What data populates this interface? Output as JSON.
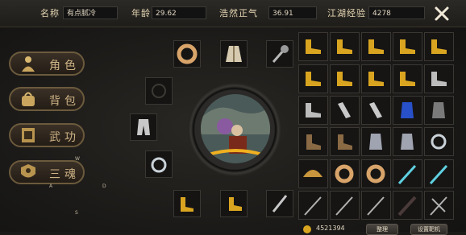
{
  "stats": [
    {
      "label": "名称",
      "value": "有点腻冷"
    },
    {
      "label": "年龄",
      "value": "29.62"
    },
    {
      "label": "浩然正气",
      "value": "36.91"
    },
    {
      "label": "江湖经验",
      "value": "4278"
    }
  ],
  "close_icon": "close-x-icon",
  "menu": [
    {
      "label": "角色",
      "icon": "character-icon"
    },
    {
      "label": "背包",
      "icon": "bag-icon"
    },
    {
      "label": "武功",
      "icon": "scroll-icon"
    },
    {
      "label": "三魂",
      "icon": "soul-icon"
    }
  ],
  "stray_letters": [
    "W",
    "A",
    "D",
    "S"
  ],
  "equipment": [
    {
      "slot": "top-left",
      "item": "jade-ring-icon"
    },
    {
      "slot": "top-center",
      "item": "robe-icon"
    },
    {
      "slot": "top-right",
      "item": "mace-icon"
    },
    {
      "slot": "left-upper",
      "item": "empty-slot-icon"
    },
    {
      "slot": "left-middle",
      "item": "pants-icon"
    },
    {
      "slot": "left-lower",
      "item": "ring-icon"
    },
    {
      "slot": "bottom-left",
      "item": "gold-boots-icon"
    },
    {
      "slot": "bottom-center",
      "item": "gold-boot-icon"
    },
    {
      "slot": "bottom-right",
      "item": "dagger-icon"
    }
  ],
  "portrait_icon": "character-portrait",
  "inventory": [
    [
      "gold-boot-icon",
      "gold-boot-icon",
      "gold-boot-icon",
      "gold-boot-icon",
      "gold-boot-icon"
    ],
    [
      "gold-boot-icon",
      "gold-boot-icon",
      "gold-boot-icon",
      "gold-boot-icon",
      "silver-boot-icon"
    ],
    [
      "silver-boot-icon",
      "silver-bracer-icon",
      "silver-bracer-icon",
      "blue-armor-icon",
      "grey-armor-icon"
    ],
    [
      "leather-boot-icon",
      "leather-boot-icon",
      "gauntlet-icon",
      "gauntlet-icon",
      "ring-icon"
    ],
    [
      "straw-hat-icon",
      "jade-ring-icon",
      "jade-ring-icon",
      "blue-sword-icon",
      "blue-sword-icon"
    ],
    [
      "spear-icon",
      "spear-icon",
      "spear-icon",
      "dark-blade-icon",
      "crossed-spear-icon"
    ]
  ],
  "coins": "4521394",
  "sort_button": "整理",
  "settings_button": "设置靶机",
  "coin_icon": "coin-pouch-icon",
  "colors": {
    "accent": "#cdb285",
    "gold": "#d9a520"
  }
}
